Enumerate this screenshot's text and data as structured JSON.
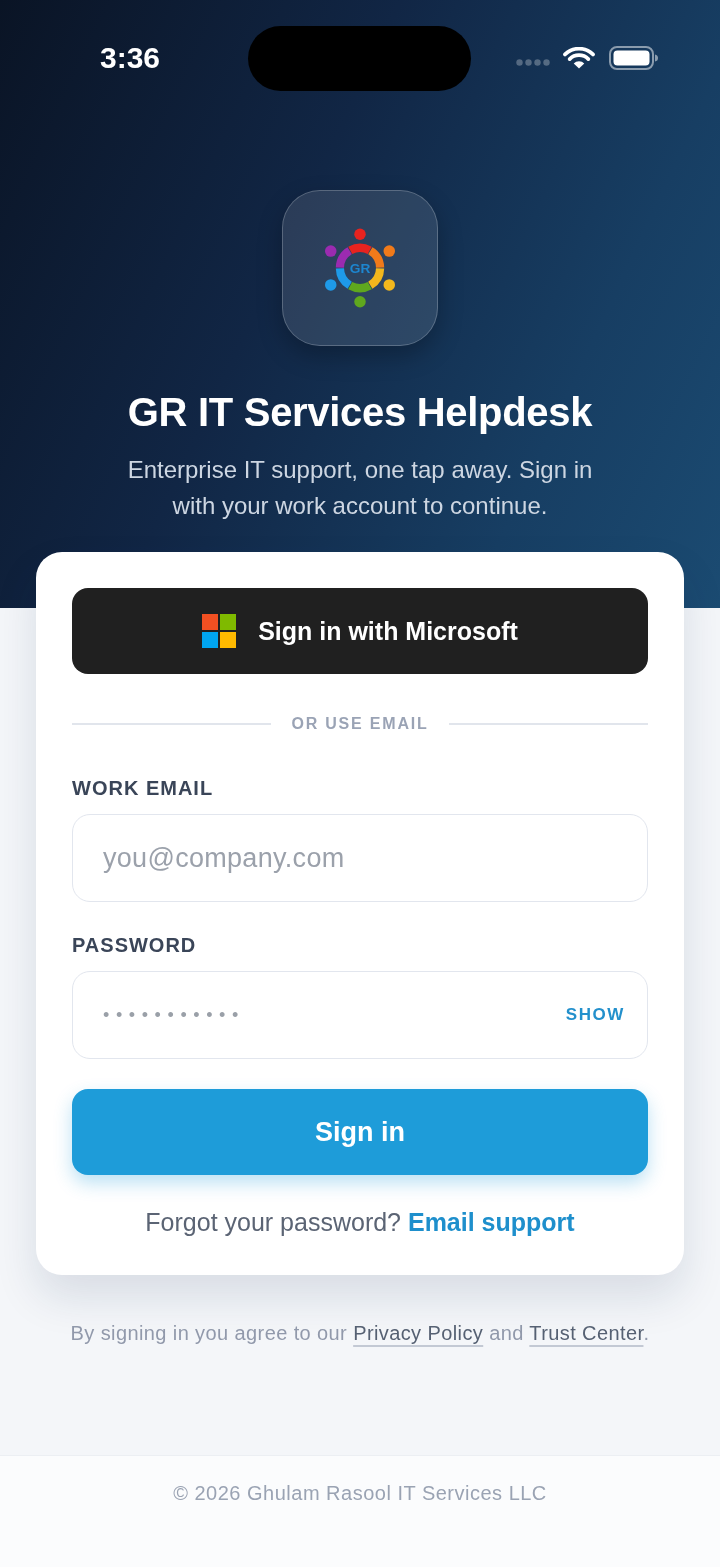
{
  "status_bar": {
    "time": "3:36"
  },
  "header": {
    "logo_text": "GR",
    "title": "GR IT Services Helpdesk",
    "subtitle": "Enterprise IT support, one tap away. Sign in with your work account to continue."
  },
  "sign_in_card": {
    "microsoft_button": "Sign in with Microsoft",
    "divider": "OR USE EMAIL",
    "fields": [
      {
        "kind": "email",
        "label": "WORK EMAIL",
        "placeholder": "you@company.com"
      },
      {
        "kind": "password",
        "label": "PASSWORD",
        "value": "•••••••••••",
        "toggle": "SHOW"
      }
    ],
    "submit_button": "Sign in",
    "forgot": {
      "text": "Forgot your password?",
      "link": "Email support"
    }
  },
  "legal": {
    "segments": [
      {
        "kind": "text",
        "text": "By signing in you agree to our "
      },
      {
        "kind": "link",
        "text": "Privacy Policy"
      },
      {
        "kind": "text",
        "text": " and "
      },
      {
        "kind": "link",
        "text": "Trust Center"
      },
      {
        "kind": "text",
        "text": "."
      }
    ]
  },
  "footer": {
    "copyright": "© 2026 Ghulam Rasool IT Services LLC"
  }
}
